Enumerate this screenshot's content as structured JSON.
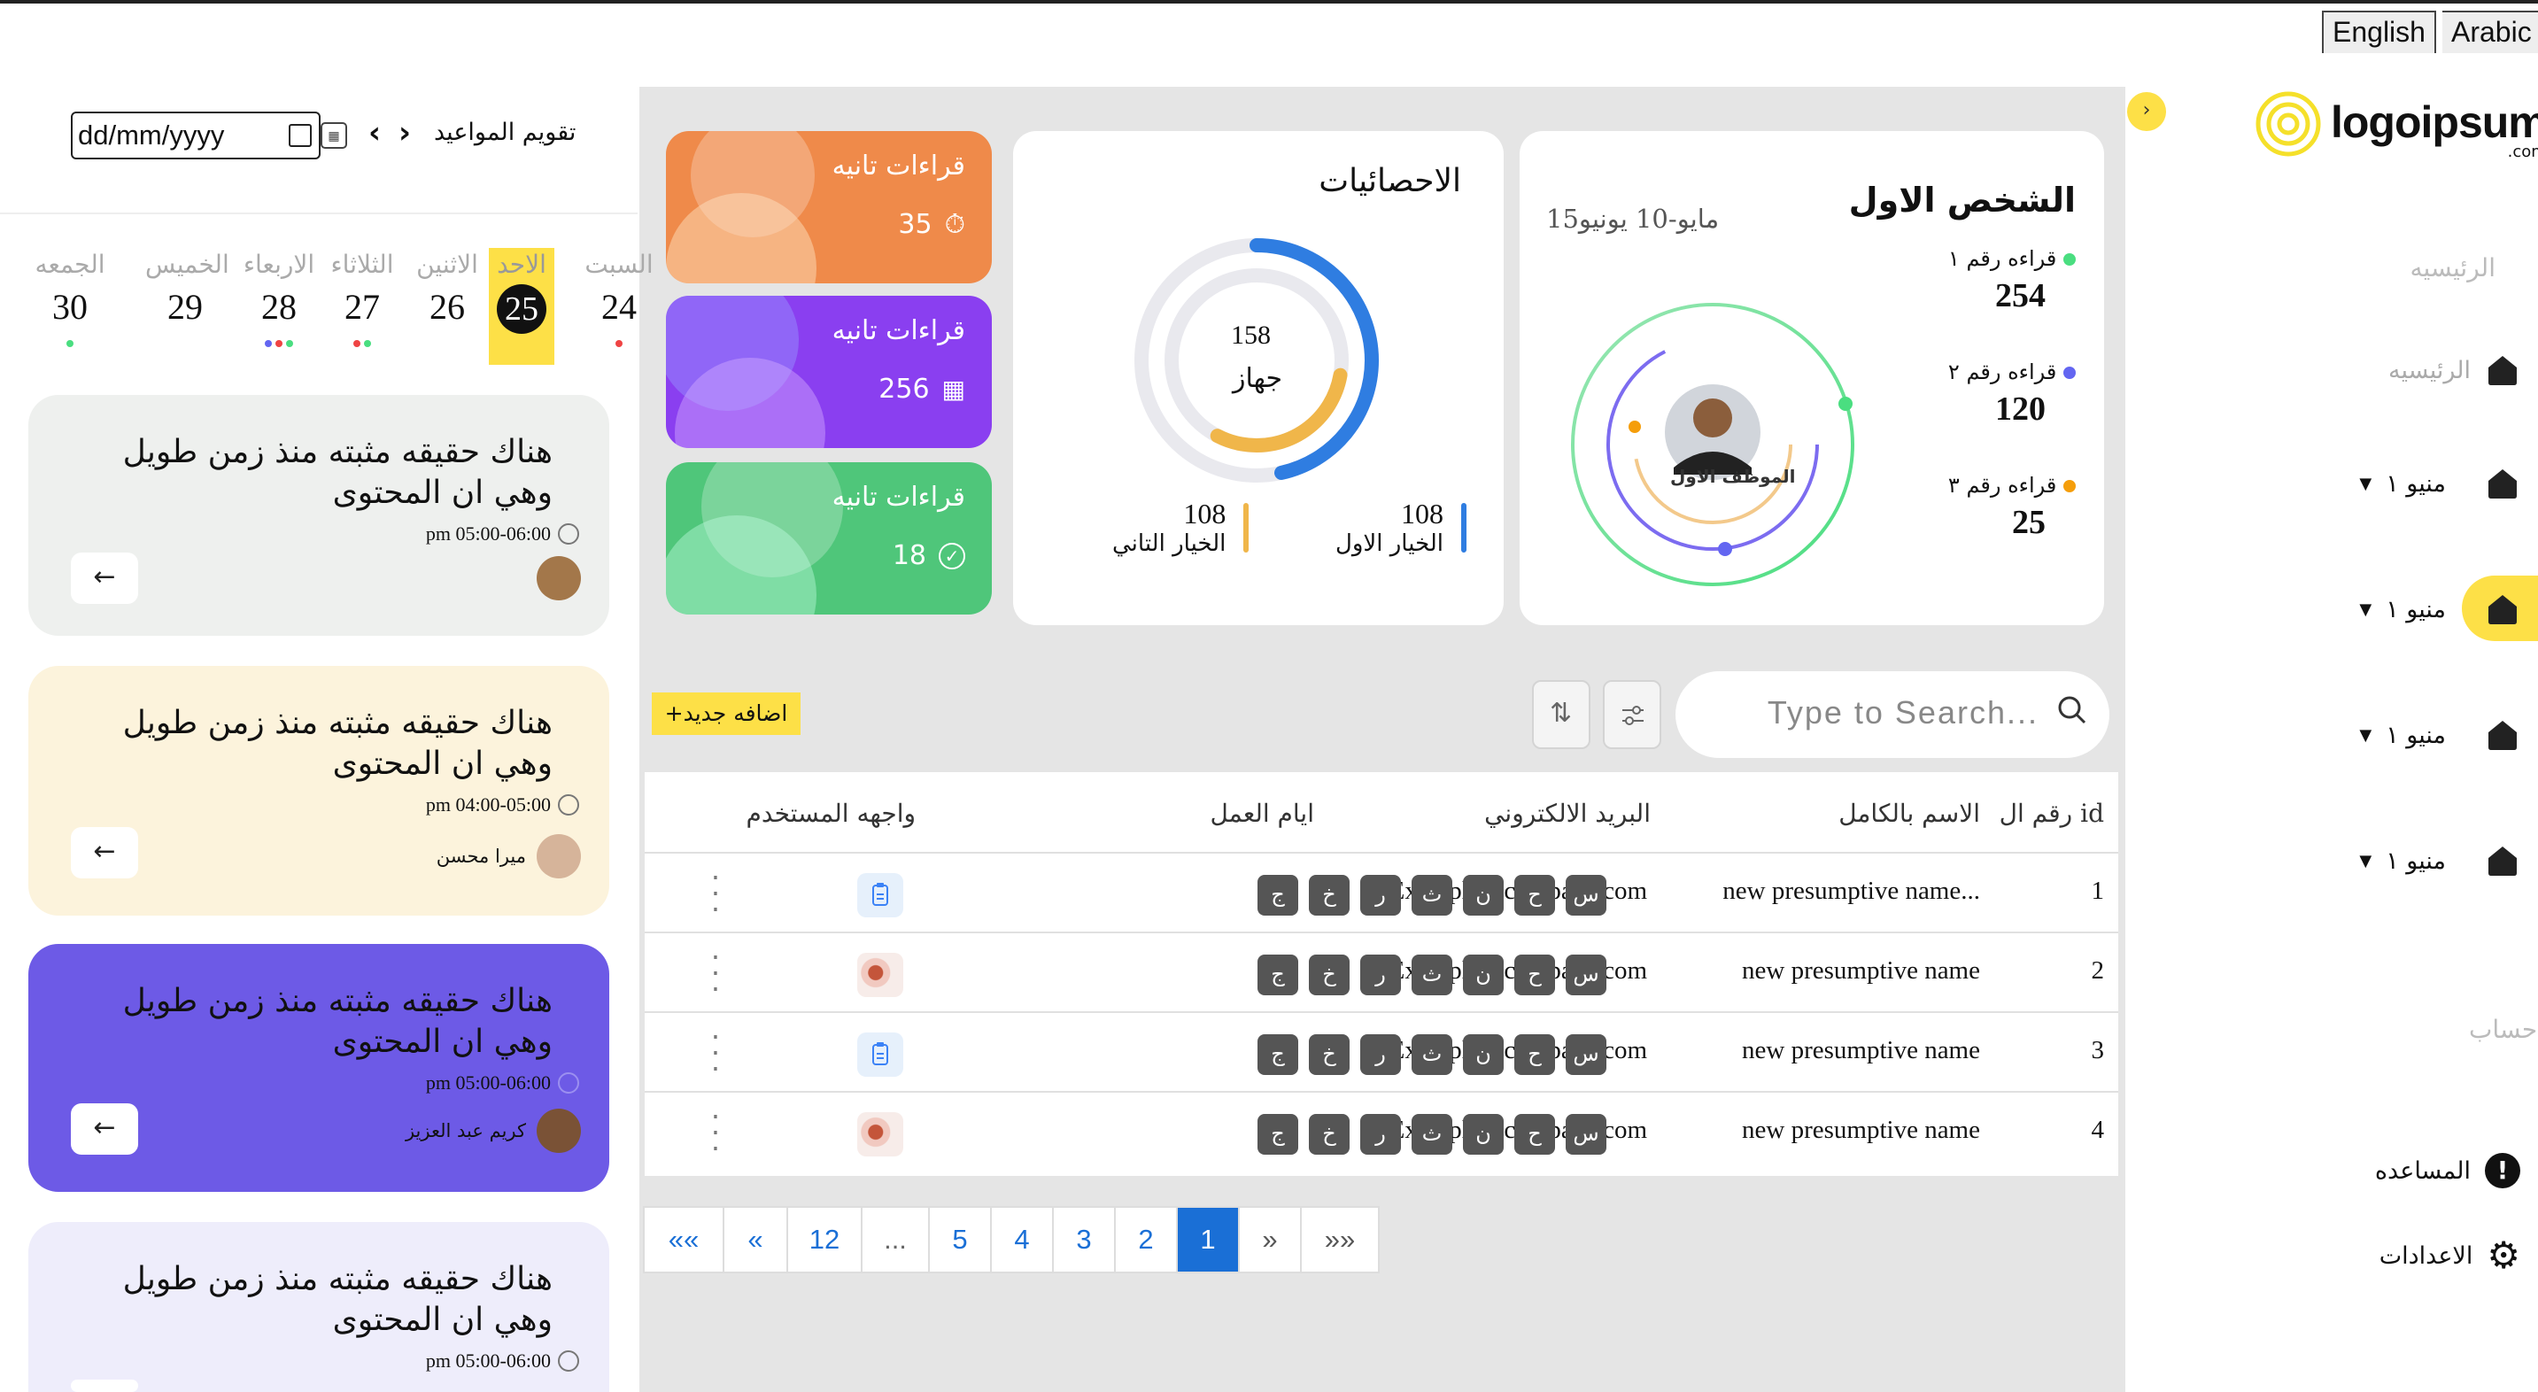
{
  "lang": {
    "english": "English",
    "arabic": "Arabic"
  },
  "logo": {
    "name": "logoipsum",
    "suffix": ".com"
  },
  "sidebar": {
    "faded_home": "الرئيسيه",
    "home": "الرئيسيه",
    "menus": [
      "منيو ١",
      "منيو ١",
      "منيو ١",
      "منيو ١"
    ],
    "account": "حساب",
    "help": "المساعده",
    "settings": "الاعدادات"
  },
  "person": {
    "title": "الشخص الاول",
    "dates": "15مايو-10 يونيو",
    "employee": "الموظف الاول",
    "readings": [
      {
        "label": "قراءه رقم ١",
        "value": "254",
        "color": "#4ade80"
      },
      {
        "label": "قراءه رقم ٢",
        "value": "120",
        "color": "#6366f1"
      },
      {
        "label": "قراءه رقم ٣",
        "value": "25",
        "color": "#f59e0b"
      }
    ]
  },
  "stats": {
    "title": "الاحصائيات",
    "center_value": "158",
    "center_label": "جهاز",
    "opt1_value": "108",
    "opt1_label": "الخيار الاول",
    "opt2_value": "108",
    "opt2_label": "الخيار التاني",
    "colors": {
      "opt1": "#2f7de1",
      "opt2": "#f0b64a"
    }
  },
  "stat_cards": [
    {
      "label": "قراءات تانيه",
      "value": "35",
      "color": "#ef8a4a",
      "icon": "timer-icon"
    },
    {
      "label": "قراءات تانيه",
      "value": "256",
      "color": "#8a3ff0",
      "icon": "calendar-icon"
    },
    {
      "label": "قراءات تانيه",
      "value": "18",
      "color": "#4fc67a",
      "icon": "check-circle-icon"
    }
  ],
  "toolbar": {
    "search_placeholder": "Type to Search...",
    "add_label": "+اضافه جديد"
  },
  "table": {
    "headers": {
      "id": "رقم ال id",
      "name": "الاسم بالكامل",
      "email": "البريد الالكتروني",
      "days": "ايام العمل",
      "ui": "واجهه المستخدم"
    },
    "day_letters": [
      "س",
      "ح",
      "ن",
      "ث",
      "ر",
      "خ",
      "ج"
    ],
    "rows": [
      {
        "id": "1",
        "name": "new presumptive name...",
        "email": "Example@company.com",
        "ui": "clipboard"
      },
      {
        "id": "2",
        "name": "new presumptive name",
        "email": "Example@company.com",
        "ui": "photo"
      },
      {
        "id": "3",
        "name": "new presumptive name",
        "email": "Example@company.com",
        "ui": "clipboard"
      },
      {
        "id": "4",
        "name": "new presumptive name",
        "email": "Example@company.com",
        "ui": "photo"
      }
    ]
  },
  "pagination": [
    "««",
    "«",
    "12",
    "...",
    "5",
    "4",
    "3",
    "2",
    "1",
    "»",
    "»»"
  ],
  "calendar": {
    "title": "تقويم المواعيد",
    "date_value": "dd/mm/yyyy",
    "days": [
      {
        "name": "السبت",
        "num": "24"
      },
      {
        "name": "الاحد",
        "num": "25"
      },
      {
        "name": "الاثنين",
        "num": "26"
      },
      {
        "name": "الثلاثاء",
        "num": "27"
      },
      {
        "name": "الاربعاء",
        "num": "28"
      },
      {
        "name": "الخميس",
        "num": "29"
      },
      {
        "name": "الجمعه",
        "num": "30"
      }
    ]
  },
  "appointments": [
    {
      "text": "هناك حقيقه مثبته منذ زمن طويل وهي ان المحتوى",
      "time": "pm 05:00-06:00",
      "person": "",
      "bg": "#eef0ee"
    },
    {
      "text": "هناك حقيقه مثبته منذ زمن طويل وهي ان المحتوى",
      "time": "pm 04:00-05:00",
      "person": "ميرا محسن",
      "bg": "#fcf3dc"
    },
    {
      "text": "هناك حقيقه مثبته منذ زمن طويل وهي ان المحتوى",
      "time": "pm 05:00-06:00",
      "person": "كريم عبد العزيز",
      "bg": "#6d5ae6"
    },
    {
      "text": "هناك حقيقه مثبته منذ زمن طويل وهي ان المحتوى",
      "time": "pm 05:00-06:00",
      "person": "",
      "bg": "#eeedfb"
    }
  ],
  "appointment_button": "←"
}
